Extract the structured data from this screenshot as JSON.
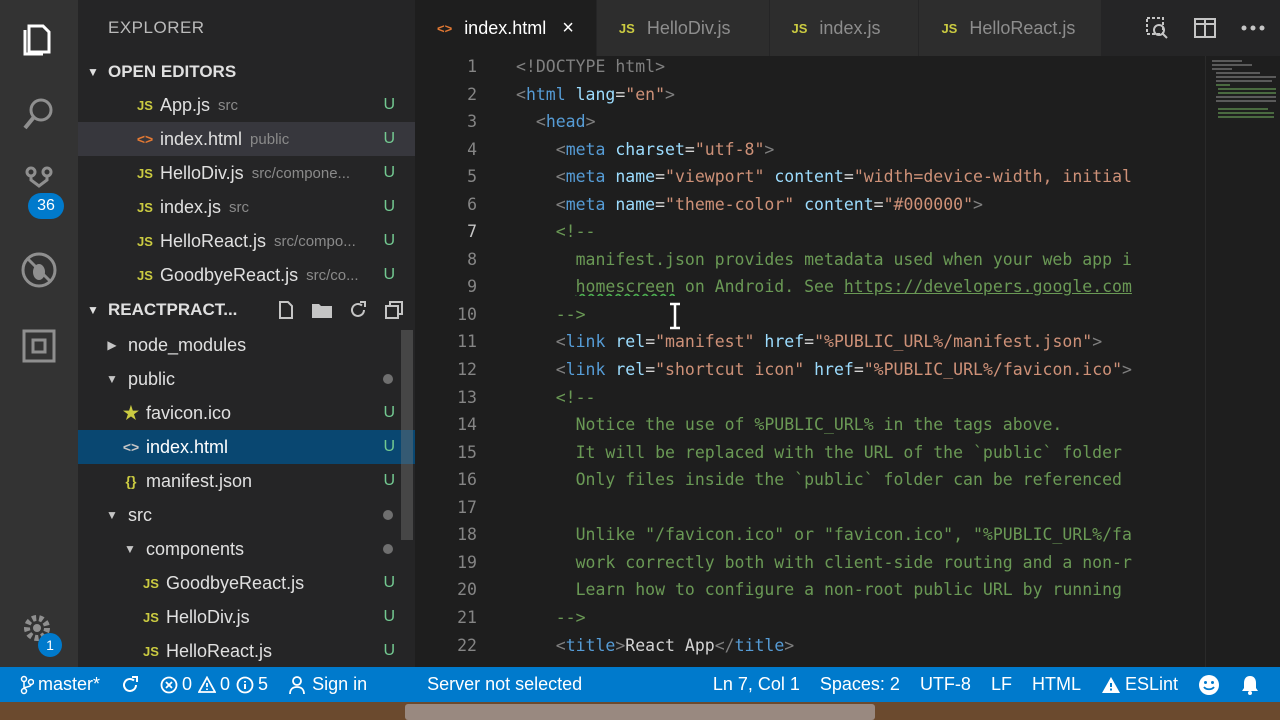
{
  "sidebar": {
    "title": "EXPLORER",
    "open_editors_label": "OPEN EDITORS",
    "open_editors": [
      {
        "name": "App.js",
        "desc": "src",
        "status": "U",
        "type": "js"
      },
      {
        "name": "index.html",
        "desc": "public",
        "status": "U",
        "type": "html"
      },
      {
        "name": "HelloDiv.js",
        "desc": "src/compone...",
        "status": "U",
        "type": "js"
      },
      {
        "name": "index.js",
        "desc": "src",
        "status": "U",
        "type": "js"
      },
      {
        "name": "HelloReact.js",
        "desc": "src/compo...",
        "status": "U",
        "type": "js"
      },
      {
        "name": "GoodbyeReact.js",
        "desc": "src/co...",
        "status": "U",
        "type": "js"
      }
    ],
    "project_label": "REACTPRACT...",
    "tree": [
      {
        "name": "node_modules"
      },
      {
        "name": "public"
      },
      {
        "name": "favicon.ico",
        "status": "U"
      },
      {
        "name": "index.html",
        "status": "U"
      },
      {
        "name": "manifest.json",
        "status": "U"
      },
      {
        "name": "src"
      },
      {
        "name": "components"
      },
      {
        "name": "GoodbyeReact.js",
        "status": "U"
      },
      {
        "name": "HelloDiv.js",
        "status": "U"
      },
      {
        "name": "HelloReact.js",
        "status": "U"
      }
    ],
    "js_glyph": "JS",
    "html_glyph": "<>",
    "json_glyph": "{}",
    "star_glyph": "★"
  },
  "activity": {
    "scm_badge": "36",
    "settings_badge": "1"
  },
  "tabs": [
    {
      "label": "index.html",
      "icon": "<>",
      "active": true
    },
    {
      "label": "HelloDiv.js",
      "icon": "JS"
    },
    {
      "label": "index.js",
      "icon": "JS"
    },
    {
      "label": "HelloReact.js",
      "icon": "JS"
    }
  ],
  "tab_close": "×",
  "editor": {
    "lines": [
      {
        "n": "1"
      },
      {
        "n": "2"
      },
      {
        "n": "3"
      },
      {
        "n": "4"
      },
      {
        "n": "5"
      },
      {
        "n": "6"
      },
      {
        "n": "7"
      },
      {
        "n": "8"
      },
      {
        "n": "9"
      },
      {
        "n": "10"
      },
      {
        "n": "11"
      },
      {
        "n": "12"
      },
      {
        "n": "13"
      },
      {
        "n": "14"
      },
      {
        "n": "15"
      },
      {
        "n": "16"
      },
      {
        "n": "17"
      },
      {
        "n": "18"
      },
      {
        "n": "19"
      },
      {
        "n": "20"
      },
      {
        "n": "21"
      },
      {
        "n": "22"
      }
    ],
    "tokens": {
      "doctype": "<!DOCTYPE html>",
      "l2_open": "<",
      "l2_html": "html",
      "l2_lang": " lang",
      "l2_eq": "=",
      "l2_val": "\"en\"",
      "l2_close": ">",
      "l3_open": "<",
      "l3_head": "head",
      "l3_close": ">",
      "l4_meta": "meta",
      "l4_attr": " charset",
      "l4_val": "\"utf-8\"",
      "l5_attr1": " name",
      "l5_val1": "\"viewport\"",
      "l5_attr2": " content",
      "l5_val2": "\"width=device-width, initial",
      "l6_val1": "\"theme-color\"",
      "l6_val2": "\"#000000\"",
      "l7": "<!--",
      "l8": "manifest.json provides metadata used when your web app i",
      "l9_a": "homescreen",
      "l9_b": " on Android. See ",
      "l9_link": "https://developers.google.com",
      "l10": "-->",
      "l11_link": "link",
      "l11_rel": " rel",
      "l11_relv": "\"manifest\"",
      "l11_href": " href",
      "l11_hrefv": "\"%PUBLIC_URL%/manifest.json\"",
      "l12_relv": "\"shortcut icon\"",
      "l12_hrefv": "\"%PUBLIC_URL%/favicon.ico\"",
      "l13": "<!--",
      "l14": "Notice the use of %PUBLIC_URL% in the tags above.",
      "l15": "It will be replaced with the URL of the `public` folder",
      "l16": "Only files inside the `public` folder can be referenced",
      "l18": "Unlike \"/favicon.ico\" or \"favicon.ico\", \"%PUBLIC_URL%/fa",
      "l19": "work correctly both with client-side routing and a non-r",
      "l20": "Learn how to configure a non-root public URL by running",
      "l21": "-->",
      "l22_title": "title",
      "l22_text": "React App",
      "l22_end": "</",
      "l22_gt": ">"
    }
  },
  "statusbar": {
    "branch": "master*",
    "errors": "0",
    "warnings": "0",
    "infos": "5",
    "sign_in": "Sign in",
    "server": "Server not selected",
    "position": "Ln 7, Col 1",
    "spaces": "Spaces: 2",
    "encoding": "UTF-8",
    "eol": "LF",
    "language": "HTML",
    "linter": "ESLint"
  }
}
